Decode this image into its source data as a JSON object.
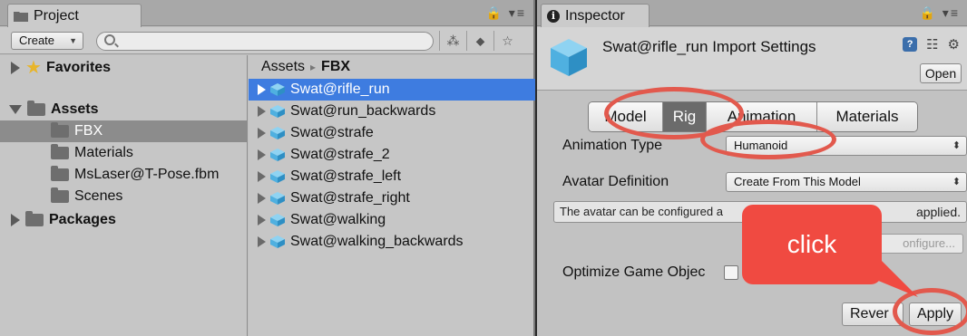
{
  "project": {
    "tab_title": "Project",
    "create_label": "Create",
    "tree": [
      {
        "label": "Favorites",
        "bold": true,
        "arrow": "right",
        "icon": "star"
      },
      {
        "label": "Assets",
        "bold": true,
        "arrow": "down",
        "icon": "folder"
      },
      {
        "label": "FBX",
        "bold": false,
        "selected": true,
        "icon": "folder"
      },
      {
        "label": "Materials",
        "bold": false,
        "icon": "folder"
      },
      {
        "label": "MsLaser@T-Pose.fbm",
        "bold": false,
        "icon": "folder"
      },
      {
        "label": "Scenes",
        "bold": false,
        "icon": "folder"
      },
      {
        "label": "Packages",
        "bold": true,
        "arrow": "right",
        "icon": "folder"
      }
    ],
    "breadcrumb": {
      "root": "Assets",
      "separator": "▸",
      "current": "FBX"
    },
    "assets": [
      "Swat@rifle_run",
      "Swat@run_backwards",
      "Swat@strafe",
      "Swat@strafe_2",
      "Swat@strafe_left",
      "Swat@strafe_right",
      "Swat@walking",
      "Swat@walking_backwards"
    ]
  },
  "inspector": {
    "tab_title": "Inspector",
    "header_title": "Swat@rifle_run Import Settings",
    "open_label": "Open",
    "tabs": {
      "model": "Model",
      "rig": "Rig",
      "animation": "Animation",
      "materials": "Materials"
    },
    "animation_type_label": "Animation Type",
    "animation_type_value": "Humanoid",
    "avatar_definition_label": "Avatar Definition",
    "avatar_definition_value": "Create From This Model",
    "help_text": "The avatar can be configured a",
    "help_text_tail": "applied.",
    "configure_label": "onfigure...",
    "optimize_label": "Optimize Game Objec",
    "revert_label": "Rever",
    "apply_label": "Apply"
  },
  "annotation": {
    "callout_text": "click",
    "color": "#f04a41"
  },
  "colors": {
    "selection_blue": "#3e7ce0",
    "active_tab": "#6b6b6b"
  }
}
